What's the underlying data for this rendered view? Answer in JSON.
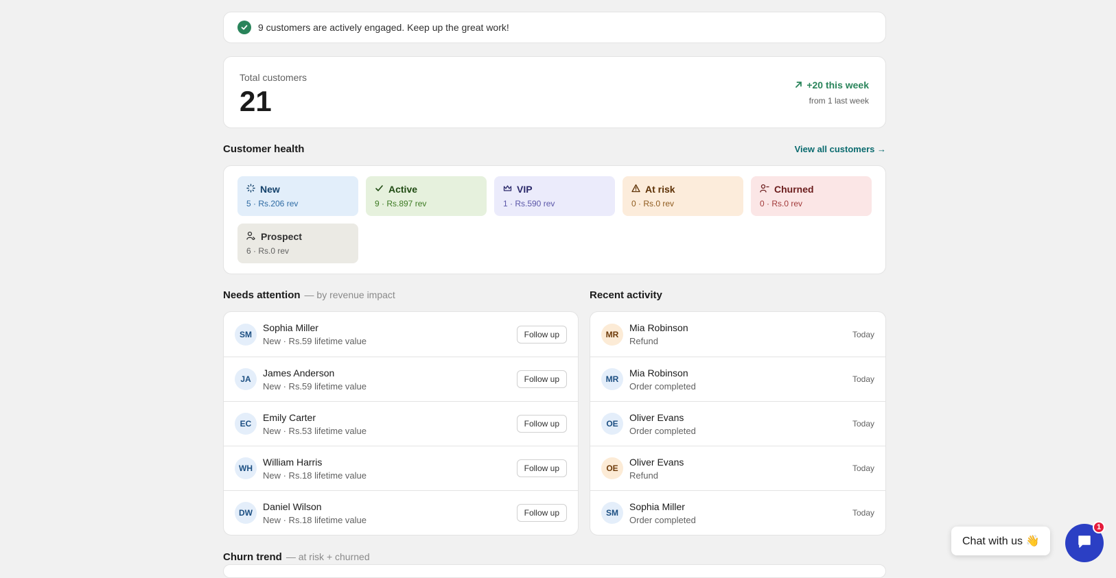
{
  "banner": {
    "text": "9 customers are actively engaged. Keep up the great work!",
    "icon": "check-circle-icon"
  },
  "totals": {
    "label": "Total customers",
    "value": "21",
    "trend": "+20 this week",
    "trend_sub": "from 1 last week"
  },
  "health": {
    "title": "Customer health",
    "link": "View all customers →",
    "tiles": [
      {
        "label": "New",
        "sub": "5 · Rs.206 rev",
        "icon": "sparkle-icon"
      },
      {
        "label": "Active",
        "sub": "9 · Rs.897 rev",
        "icon": "check-icon"
      },
      {
        "label": "VIP",
        "sub": "1 · Rs.590 rev",
        "icon": "crown-icon"
      },
      {
        "label": "At risk",
        "sub": "0 · Rs.0 rev",
        "icon": "alert-triangle-icon"
      },
      {
        "label": "Churned",
        "sub": "0 · Rs.0 rev",
        "icon": "user-minus-icon"
      },
      {
        "label": "Prospect",
        "sub": "6 · Rs.0 rev",
        "icon": "user-arrow-icon"
      }
    ]
  },
  "attention": {
    "title": "Needs attention",
    "subtitle": "— by revenue impact",
    "button_label": "Follow up",
    "rows": [
      {
        "initials": "SM",
        "name": "Sophia Miller",
        "sub": "New · Rs.59 lifetime value"
      },
      {
        "initials": "JA",
        "name": "James Anderson",
        "sub": "New · Rs.59 lifetime value"
      },
      {
        "initials": "EC",
        "name": "Emily Carter",
        "sub": "New · Rs.53 lifetime value"
      },
      {
        "initials": "WH",
        "name": "William Harris",
        "sub": "New · Rs.18 lifetime value"
      },
      {
        "initials": "DW",
        "name": "Daniel Wilson",
        "sub": "New · Rs.18 lifetime value"
      }
    ]
  },
  "activity": {
    "title": "Recent activity",
    "rows": [
      {
        "initials": "MR",
        "name": "Mia Robinson",
        "sub": "Refund",
        "time": "Today"
      },
      {
        "initials": "MR",
        "name": "Mia Robinson",
        "sub": "Order completed",
        "time": "Today"
      },
      {
        "initials": "OE",
        "name": "Oliver Evans",
        "sub": "Order completed",
        "time": "Today"
      },
      {
        "initials": "OE",
        "name": "Oliver Evans",
        "sub": "Refund",
        "time": "Today"
      },
      {
        "initials": "SM",
        "name": "Sophia Miller",
        "sub": "Order completed",
        "time": "Today"
      }
    ]
  },
  "churn": {
    "title": "Churn trend",
    "subtitle": "— at risk + churned"
  },
  "chat": {
    "label": "Chat with us 👋",
    "badge": "1",
    "icon": "chat-bubble-icon"
  },
  "colors": {
    "accent_green": "#29845a",
    "chat_blue": "#2b3fc4",
    "badge_red": "#e51c3c",
    "link_teal": "#0b6b6f"
  }
}
